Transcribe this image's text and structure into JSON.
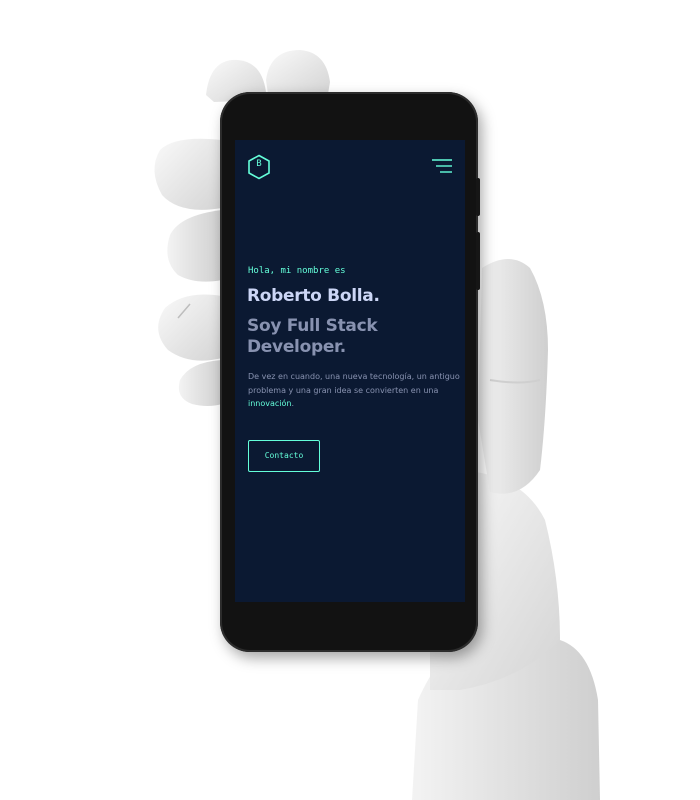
{
  "header": {
    "logo_letter": "B",
    "logo_icon": "hexagon-logo-icon",
    "menu_icon": "hamburger-menu-icon"
  },
  "hero": {
    "greeting": "Hola, mi nombre es",
    "name": "Roberto Bolla.",
    "role": "Soy Full Stack Developer.",
    "blurb_text": "De vez en cuando, una nueva tecnología, un antiguo problema y una gran idea se convierten en una ",
    "blurb_link": "innovación",
    "blurb_end": "."
  },
  "cta": {
    "label": "Contacto"
  },
  "colors": {
    "background": "#0b1932",
    "accent": "#64ffda",
    "heading": "#ccd6f6",
    "muted": "#8892b0"
  }
}
